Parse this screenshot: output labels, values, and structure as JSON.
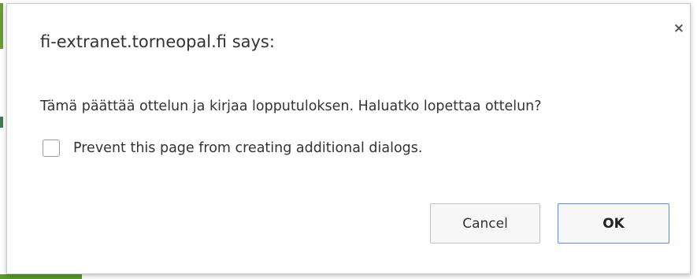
{
  "dialog": {
    "title": "fi-extranet.torneopal.fi says:",
    "close_glyph": "×",
    "message": "Tämä päättää ottelun ja kirjaa lopputuloksen. Haluatko lopettaa ottelun?",
    "checkbox_label": "Prevent this page from creating additional dialogs.",
    "checkbox_checked": false,
    "cancel_label": "Cancel",
    "ok_label": "OK"
  },
  "colors": {
    "ok_border": "#4d90fe",
    "text": "#333333",
    "page_edge_green": "#6a9a3a"
  }
}
